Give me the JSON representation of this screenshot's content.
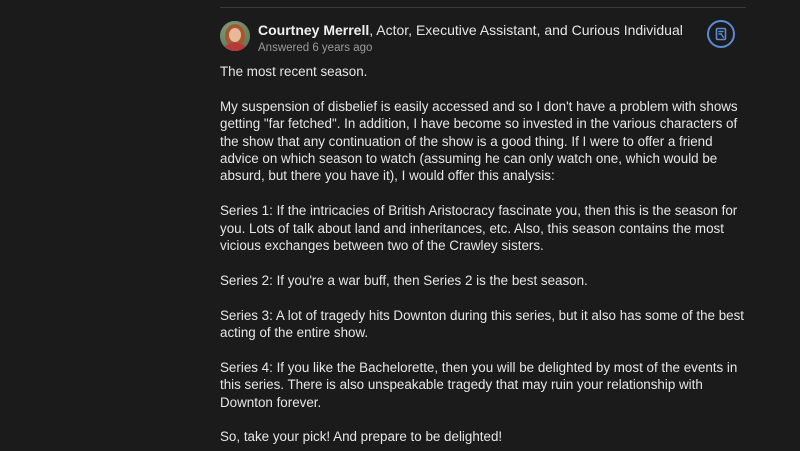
{
  "author": {
    "name": "Courtney Merrell",
    "credentials": ", Actor, Executive Assistant, and Curious Individual",
    "answered": "Answered 6 years ago"
  },
  "icons": {
    "avatar": "user-avatar",
    "action": "bookmark-icon"
  },
  "colors": {
    "background": "#1b1b1b",
    "text": "#e6e6e6",
    "muted": "#9a9a9a",
    "accent": "#5b8bd6"
  },
  "answer": {
    "paragraphs": [
      "The most recent season.",
      "My suspension of disbelief is easily accessed and so I don't have a problem with shows getting \"far fetched\". In addition, I have become so invested in the various characters of the show that any continuation of the show is a good thing. If I were to offer a friend advice on which season to watch (assuming he can only watch one, which would be absurd, but there you have it), I would offer this analysis:",
      "Series 1: If the intricacies of British Aristocracy fascinate you, then this is the season for you. Lots of talk about land and inheritances, etc. Also, this season contains the most vicious exchanges between two of the Crawley sisters.",
      "Series 2: If you're a war buff, then Series 2 is the best season.",
      "Series 3: A lot of tragedy hits Downton during this series, but it also has some of the best acting of the entire show.",
      "Series 4: If you like the Bachelorette, then you will be delighted by most of the events in this series. There is also unspeakable tragedy that may ruin your relationship with Downton forever.",
      "So, take your pick! And prepare to be delighted!"
    ]
  }
}
